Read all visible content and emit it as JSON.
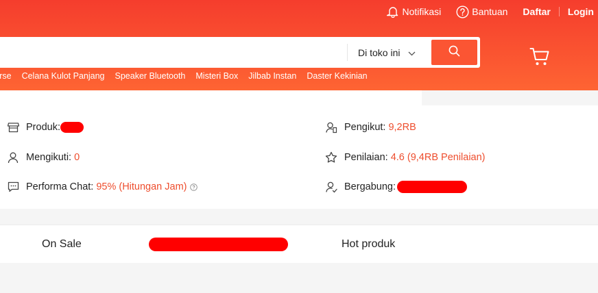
{
  "topnav": {
    "notifications_label": "Notifikasi",
    "help_label": "Bantuan",
    "register_label": "Daftar",
    "login_label": "Login"
  },
  "search": {
    "value": "",
    "scope_label": "Di toko ini"
  },
  "keywords": [
    "verse",
    "Celana Kulot Panjang",
    "Speaker Bluetooth",
    "Misteri Box",
    "Jilbab Instan",
    "Daster Kekinian"
  ],
  "shop_stats": {
    "products": {
      "label": "Produk:",
      "value": ""
    },
    "following": {
      "label": "Mengikuti:",
      "value": "0"
    },
    "chat_performance": {
      "label": "Performa Chat:",
      "value": "95% (Hitungan Jam)"
    },
    "followers": {
      "label": "Pengikut:",
      "value": "9,2RB"
    },
    "rating": {
      "label": "Penilaian:",
      "value": "4.6 (9,4RB Penilaian)"
    },
    "joined": {
      "label": "Bergabung:",
      "value": ""
    }
  },
  "tabs": [
    "On Sale",
    "",
    "Hot produk"
  ],
  "colors": {
    "brand_top": "#f53d2d",
    "brand_bottom": "#fe6433",
    "accent_text": "#ee4d2d",
    "redaction": "#ff0000"
  }
}
